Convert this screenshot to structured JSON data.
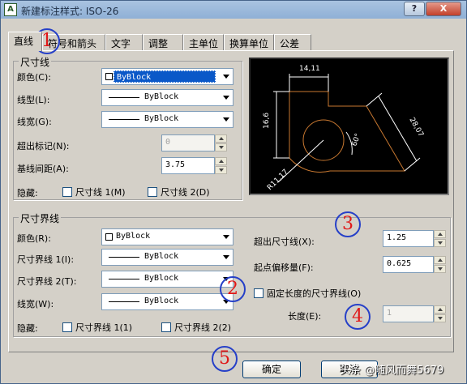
{
  "window": {
    "title": "新建标注样式: ISO-26",
    "app_icon": "A",
    "help": "?",
    "close": "X"
  },
  "tabs": [
    "直线",
    "符号和箭头",
    "文字",
    "调整",
    "主单位",
    "换算单位",
    "公差"
  ],
  "dim_lines": {
    "title": "尺寸线",
    "color_label": "颜色(C):",
    "color_value": "ByBlock",
    "linetype_label": "线型(L):",
    "linetype_value": "ByBlock",
    "lineweight_label": "线宽(G):",
    "lineweight_value": "ByBlock",
    "extend_label": "超出标记(N):",
    "extend_value": "0",
    "baseline_label": "基线间距(A):",
    "baseline_value": "3.75",
    "suppress_label": "隐藏:",
    "suppress1": "尺寸线 1(M)",
    "suppress2": "尺寸线 2(D)"
  },
  "preview": {
    "dim1": "14,11",
    "dim2": "16,6",
    "dim3": "28,07",
    "angle": "60°",
    "radius": "R11,17"
  },
  "ext_lines": {
    "title": "尺寸界线",
    "color_label": "颜色(R):",
    "color_value": "ByBlock",
    "ext1_label": "尺寸界线 1(I):",
    "ext1_value": "ByBlock",
    "ext2_label": "尺寸界线 2(T):",
    "ext2_value": "ByBlock",
    "lineweight_label": "线宽(W):",
    "lineweight_value": "ByBlock",
    "suppress_label": "隐藏:",
    "suppress1": "尺寸界线 1(1)",
    "suppress2": "尺寸界线 2(2)",
    "beyond_label": "超出尺寸线(X):",
    "beyond_value": "1.25",
    "offset_label": "起点偏移量(F):",
    "offset_value": "0.625",
    "fixed_label": "固定长度的尺寸界线(O)",
    "length_label": "长度(E):",
    "length_value": "1"
  },
  "annotations": [
    "1",
    "2",
    "3",
    "4",
    "5"
  ],
  "buttons": {
    "ok": "确定",
    "cancel": "取消"
  },
  "watermark": "头条 @随风而舞5679",
  "colors": {
    "annotation_circle": "#2640c8",
    "annotation_number": "#e01818",
    "preview_geometry": "#c87830",
    "preview_dim": "#ffffff"
  }
}
